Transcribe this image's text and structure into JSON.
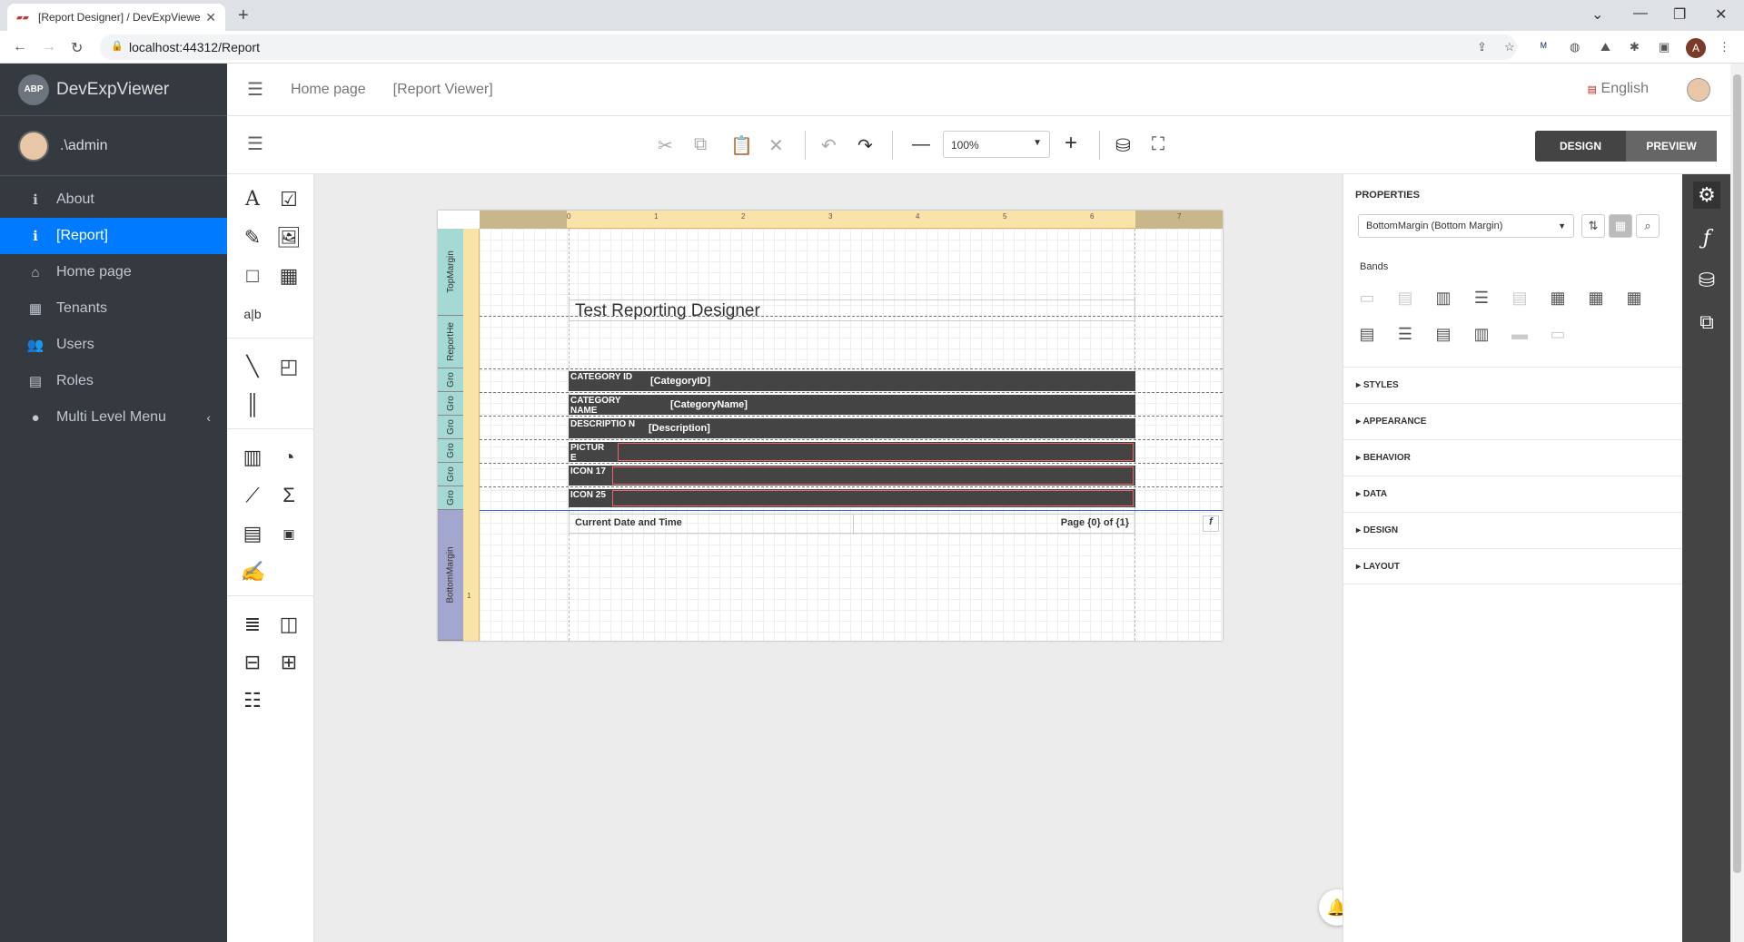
{
  "browser": {
    "tab_title": "[Report Designer] / DevExpViewe",
    "url": "localhost:44312/Report",
    "profile_initial": "A"
  },
  "sidebar": {
    "brand": "DevExpViewer",
    "logo_text": "ABP",
    "user": ".\\admin",
    "items": [
      {
        "label": "About",
        "icon": "info-icon"
      },
      {
        "label": "[Report]",
        "icon": "info-icon",
        "active": true
      },
      {
        "label": "Home page",
        "icon": "home-icon"
      },
      {
        "label": "Tenants",
        "icon": "building-icon"
      },
      {
        "label": "Users",
        "icon": "users-icon"
      },
      {
        "label": "Roles",
        "icon": "id-card-icon"
      },
      {
        "label": "Multi Level Menu",
        "icon": "circle-icon"
      }
    ]
  },
  "topnav": {
    "links": [
      "Home page",
      "[Report Viewer]"
    ],
    "language": "English"
  },
  "toolbar": {
    "zoom": "100%",
    "design_label": "DESIGN",
    "preview_label": "PREVIEW"
  },
  "report": {
    "bands": [
      "TopMargin",
      "ReportHe",
      "Gro",
      "Gro",
      "Gro",
      "Gro",
      "Gro",
      "Gro",
      "BottomMargin"
    ],
    "ruler": [
      "0",
      "1",
      "2",
      "3",
      "4",
      "5",
      "6",
      "7"
    ],
    "vruler_bottom": "1",
    "title": "Test Reporting Designer",
    "rows": [
      {
        "label": "CATEGORY ID",
        "value": "[CategoryID]"
      },
      {
        "label": "CATEGORY NAME",
        "value": "[CategoryName]"
      },
      {
        "label": "DESCRIPTIO N",
        "value": "[Description]"
      },
      {
        "label": "PICTUR E",
        "value": ""
      },
      {
        "label": "ICON 17",
        "value": ""
      },
      {
        "label": "ICON 25",
        "value": ""
      }
    ],
    "footer_left": "Current Date and Time",
    "footer_right": "Page {0} of {1}"
  },
  "properties": {
    "header": "PROPERTIES",
    "selected": "BottomMargin (Bottom Margin)",
    "bands_label": "Bands",
    "sections": [
      "STYLES",
      "APPEARANCE",
      "BEHAVIOR",
      "DATA",
      "DESIGN",
      "LAYOUT"
    ]
  },
  "colors": {
    "sidebar_bg": "#343a40",
    "active": "#007bff",
    "band_label": "#a5d9d3",
    "ruler": "#fae3a8"
  }
}
